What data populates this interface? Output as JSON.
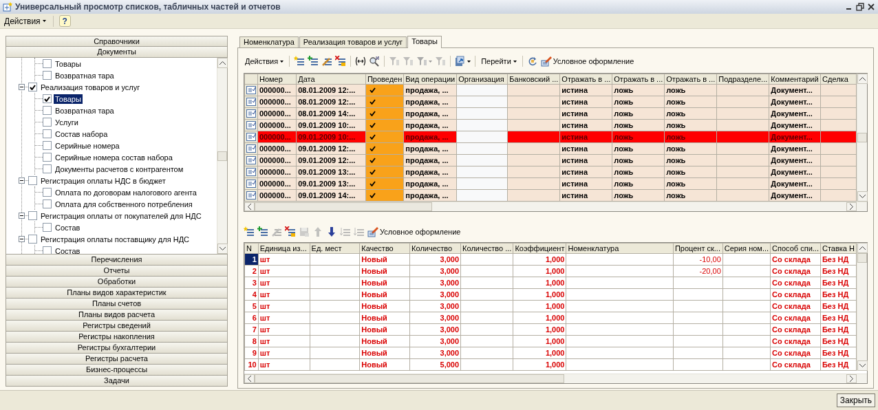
{
  "window": {
    "title": "Универсальный просмотр списков, табличных частей и отчетов"
  },
  "menu": [
    {
      "kind": "menu",
      "label": "Действия"
    },
    {
      "kind": "help",
      "label": "?"
    }
  ],
  "sections_above": [
    "Справочники",
    "Документы"
  ],
  "sections_below": [
    "Перечисления",
    "Отчеты",
    "Обработки",
    "Планы видов характеристик",
    "Планы счетов",
    "Планы видов расчета",
    "Регистры сведений",
    "Регистры накопления",
    "Регистры бухгалтерии",
    "Регистры расчета",
    "Бизнес-процессы",
    "Задачи"
  ],
  "tree": [
    {
      "children": [
        {
          "label": "Товары",
          "checked": false,
          "selected": false
        },
        {
          "label": "Возвратная тара",
          "checked": false,
          "selected": false
        }
      ]
    },
    {
      "label": "Реализация товаров и услуг",
      "checked": true,
      "expanded": true,
      "selected": false,
      "children": [
        {
          "label": "Товары",
          "checked": true,
          "selected": true
        },
        {
          "label": "Возвратная тара",
          "checked": false,
          "selected": false
        },
        {
          "label": "Услуги",
          "checked": false,
          "selected": false
        },
        {
          "label": "Состав набора",
          "checked": false,
          "selected": false
        },
        {
          "label": "Серийные номера",
          "checked": false,
          "selected": false
        },
        {
          "label": "Серийные номера состав набора",
          "checked": false,
          "selected": false
        },
        {
          "label": "Документы расчетов с контрагентом",
          "checked": false,
          "selected": false
        }
      ]
    },
    {
      "label": "Регистрация оплаты НДС в бюджет",
      "checked": false,
      "expanded": true,
      "selected": false,
      "children": [
        {
          "label": "Оплата по договорам налогового агента",
          "checked": false,
          "selected": false
        },
        {
          "label": "Оплата для собственного потребления",
          "checked": false,
          "selected": false
        }
      ]
    },
    {
      "label": "Регистрация оплаты от покупателей для НДС",
      "checked": false,
      "expanded": true,
      "selected": false,
      "children": [
        {
          "label": "Состав",
          "checked": false,
          "selected": false
        }
      ]
    },
    {
      "label": "Регистрация оплаты поставщику для НДС",
      "checked": false,
      "expanded": true,
      "selected": false,
      "children": [
        {
          "label": "Состав",
          "checked": false,
          "selected": false
        }
      ]
    }
  ],
  "tabs": [
    {
      "label": "Номенклатура",
      "selected": false
    },
    {
      "label": "Реализация товаров и услуг",
      "selected": false
    },
    {
      "label": "Товары",
      "selected": true
    }
  ],
  "upper_toolbar": [
    {
      "kind": "menu",
      "label": "Действия"
    },
    {
      "kind": "separator"
    },
    {
      "kind": "icon",
      "disabled": false
    },
    {
      "kind": "icon",
      "disabled": false
    },
    {
      "kind": "icon",
      "disabled": false
    },
    {
      "kind": "icon",
      "disabled": false
    },
    {
      "kind": "separator"
    },
    {
      "kind": "icon",
      "disabled": false
    },
    {
      "kind": "icon",
      "disabled": false
    },
    {
      "kind": "separator"
    },
    {
      "kind": "icon",
      "disabled": true
    },
    {
      "kind": "icon",
      "disabled": true
    },
    {
      "kind": "icon-menu",
      "disabled": true
    },
    {
      "kind": "icon",
      "disabled": true
    },
    {
      "kind": "separator"
    },
    {
      "kind": "icon-menu",
      "disabled": false
    },
    {
      "kind": "separator"
    },
    {
      "kind": "menu",
      "label": "Перейти"
    },
    {
      "kind": "separator"
    },
    {
      "kind": "icon",
      "disabled": false
    },
    {
      "kind": "icon-label",
      "label": "Условное оформление",
      "disabled": false
    }
  ],
  "documents": {
    "columns": [
      "Номер",
      "Дата",
      "Проведен",
      "Вид операции",
      "Организация",
      "Банковский ...",
      "Отражать в ...",
      "Отражать в ...",
      "Отражать в ...",
      "Подразделе...",
      "Комментарий",
      "Сделка"
    ],
    "rows": [
      {
        "number": "000000...",
        "date": "08.01.2009 12:...",
        "posted": true,
        "operation": "продажа, ...",
        "flags": [
          "истина",
          "ложь",
          "ложь"
        ],
        "comment": "Документ...",
        "highlighted": false
      },
      {
        "number": "000000...",
        "date": "08.01.2009 12:...",
        "posted": true,
        "operation": "продажа, ...",
        "flags": [
          "истина",
          "ложь",
          "ложь"
        ],
        "comment": "Документ...",
        "highlighted": false
      },
      {
        "number": "000000...",
        "date": "08.01.2009 14:...",
        "posted": true,
        "operation": "продажа, ...",
        "flags": [
          "истина",
          "ложь",
          "ложь"
        ],
        "comment": "Документ...",
        "highlighted": false
      },
      {
        "number": "000000...",
        "date": "09.01.2009 10:...",
        "posted": true,
        "operation": "продажа, ...",
        "flags": [
          "истина",
          "ложь",
          "ложь"
        ],
        "comment": "Документ...",
        "highlighted": false
      },
      {
        "number": "000000...",
        "date": "09.01.2009 10:...",
        "posted": true,
        "operation": "продажа, ...",
        "flags": [
          "истина",
          "ложь",
          "ложь"
        ],
        "comment": "Документ...",
        "highlighted": true
      },
      {
        "number": "000000...",
        "date": "09.01.2009 12:...",
        "posted": true,
        "operation": "продажа, ...",
        "flags": [
          "истина",
          "ложь",
          "ложь"
        ],
        "comment": "Документ...",
        "highlighted": false
      },
      {
        "number": "000000...",
        "date": "09.01.2009 12:...",
        "posted": true,
        "operation": "продажа, ...",
        "flags": [
          "истина",
          "ложь",
          "ложь"
        ],
        "comment": "Документ...",
        "highlighted": false
      },
      {
        "number": "000000...",
        "date": "09.01.2009 13:...",
        "posted": true,
        "operation": "продажа, ...",
        "flags": [
          "истина",
          "ложь",
          "ложь"
        ],
        "comment": "Документ...",
        "highlighted": false
      },
      {
        "number": "000000...",
        "date": "09.01.2009 13:...",
        "posted": true,
        "operation": "продажа, ...",
        "flags": [
          "истина",
          "ложь",
          "ложь"
        ],
        "comment": "Документ...",
        "highlighted": false
      },
      {
        "number": "000000...",
        "date": "09.01.2009 14:...",
        "posted": true,
        "operation": "продажа, ...",
        "flags": [
          "истина",
          "ложь",
          "ложь"
        ],
        "comment": "Документ...",
        "highlighted": false
      }
    ]
  },
  "lower_toolbar": [
    {
      "kind": "icon",
      "disabled": false
    },
    {
      "kind": "icon",
      "disabled": false
    },
    {
      "kind": "icon",
      "disabled": true
    },
    {
      "kind": "icon",
      "disabled": false
    },
    {
      "kind": "icon",
      "disabled": true
    },
    {
      "kind": "icon",
      "disabled": true
    },
    {
      "kind": "icon",
      "disabled": false
    },
    {
      "kind": "icon",
      "disabled": true
    },
    {
      "kind": "icon",
      "disabled": true
    },
    {
      "kind": "icon-label",
      "label": "Условное оформление",
      "disabled": false
    }
  ],
  "goods": {
    "columns": [
      "N",
      "Единица из...",
      "Ед. мест",
      "Качество",
      "Количество",
      "Количество ...",
      "Коэффициент",
      "Номенклатура",
      "Процент ск...",
      "Серия ном...",
      "Способ спи...",
      "Ставка Н"
    ],
    "rows": [
      {
        "n": "1",
        "unit": "шт",
        "quality": "Новый",
        "quantity": "3,000",
        "coefficient": "1,000",
        "discount": "-10,00",
        "method": "Со склада",
        "vat": "Без НД",
        "selected": true
      },
      {
        "n": "2",
        "unit": "шт",
        "quality": "Новый",
        "quantity": "3,000",
        "coefficient": "1,000",
        "discount": "-20,00",
        "method": "Со склада",
        "vat": "Без НД",
        "selected": false
      },
      {
        "n": "3",
        "unit": "шт",
        "quality": "Новый",
        "quantity": "3,000",
        "coefficient": "1,000",
        "method": "Со склада",
        "vat": "Без НД",
        "selected": false
      },
      {
        "n": "4",
        "unit": "шт",
        "quality": "Новый",
        "quantity": "3,000",
        "coefficient": "1,000",
        "method": "Со склада",
        "vat": "Без НД",
        "selected": false
      },
      {
        "n": "5",
        "unit": "шт",
        "quality": "Новый",
        "quantity": "3,000",
        "coefficient": "1,000",
        "method": "Со склада",
        "vat": "Без НД",
        "selected": false
      },
      {
        "n": "6",
        "unit": "шт",
        "quality": "Новый",
        "quantity": "3,000",
        "coefficient": "1,000",
        "method": "Со склада",
        "vat": "Без НД",
        "selected": false
      },
      {
        "n": "7",
        "unit": "шт",
        "quality": "Новый",
        "quantity": "3,000",
        "coefficient": "1,000",
        "method": "Со склада",
        "vat": "Без НД",
        "selected": false
      },
      {
        "n": "8",
        "unit": "шт",
        "quality": "Новый",
        "quantity": "3,000",
        "coefficient": "1,000",
        "method": "Со склада",
        "vat": "Без НД",
        "selected": false
      },
      {
        "n": "9",
        "unit": "шт",
        "quality": "Новый",
        "quantity": "3,000",
        "coefficient": "1,000",
        "method": "Со склада",
        "vat": "Без НД",
        "selected": false
      },
      {
        "n": "10",
        "unit": "шт",
        "quality": "Новый",
        "quantity": "5,000",
        "coefficient": "1,000",
        "method": "Со склада",
        "vat": "Без НД",
        "selected": false
      }
    ]
  },
  "footer": {
    "close": "Закрыть"
  }
}
